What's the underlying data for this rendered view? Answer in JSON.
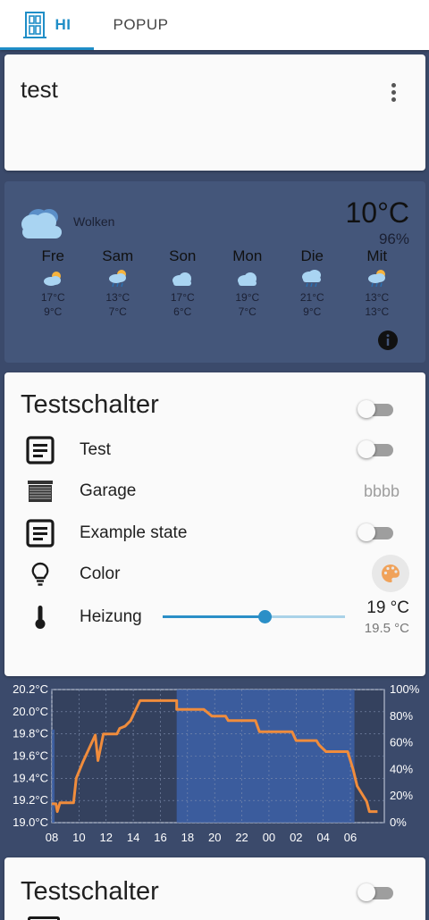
{
  "tabs": [
    {
      "label": "HI",
      "icon": "door-icon",
      "active": true
    },
    {
      "label": "POPUP",
      "active": false
    }
  ],
  "test_card": {
    "title": "test",
    "menu_icon": "dots-vertical-icon"
  },
  "weather": {
    "condition": "Wolken",
    "temperature": "10°C",
    "humidity": "96%",
    "forecast": [
      {
        "day": "Fre",
        "high": "17°C",
        "low": "9°C",
        "icon": "partly-cloudy-icon"
      },
      {
        "day": "Sam",
        "high": "13°C",
        "low": "7°C",
        "icon": "partly-cloudy-rain-icon"
      },
      {
        "day": "Son",
        "high": "17°C",
        "low": "6°C",
        "icon": "cloudy-icon"
      },
      {
        "day": "Mon",
        "high": "19°C",
        "low": "7°C",
        "icon": "cloudy-icon"
      },
      {
        "day": "Die",
        "high": "21°C",
        "low": "9°C",
        "icon": "cloudy-rain-icon"
      },
      {
        "day": "Mit",
        "high": "13°C",
        "low": "13°C",
        "icon": "partly-cloudy-rain-icon"
      }
    ]
  },
  "entities": {
    "title": "Testschalter",
    "header_toggle_on": false,
    "rows": [
      {
        "label": "Test",
        "icon": "text-box-icon",
        "type": "toggle",
        "on": false
      },
      {
        "label": "Garage",
        "icon": "garage-icon",
        "type": "state",
        "state": "bbbb"
      },
      {
        "label": "Example state",
        "icon": "text-box-icon",
        "type": "toggle",
        "on": false
      },
      {
        "label": "Color",
        "icon": "lightbulb-icon",
        "type": "color",
        "button_icon": "palette-icon"
      },
      {
        "label": "Heizung",
        "icon": "thermometer-icon",
        "type": "climate",
        "slider_fraction": 0.56,
        "current": "19 °C",
        "target": "19.5 °C"
      }
    ]
  },
  "chart_data": {
    "type": "line",
    "x_ticks": [
      "08",
      "10",
      "12",
      "14",
      "16",
      "18",
      "20",
      "22",
      "00",
      "02",
      "04",
      "06"
    ],
    "y_ticks_left": [
      "19.0°C",
      "19.2°C",
      "19.4°C",
      "19.6°C",
      "19.8°C",
      "20.0°C",
      "20.2°C"
    ],
    "y_ticks_right": [
      "0%",
      "20%",
      "40%",
      "60%",
      "80%",
      "100%"
    ],
    "ylim_left": [
      19.0,
      20.2
    ],
    "ylim_right": [
      0,
      100
    ],
    "xlim_hours": [
      8,
      8.5
    ],
    "line_color": "#f08c3c",
    "band_color": "#3d62a8",
    "series": [
      {
        "x": [
          8.0,
          8.3,
          8.4,
          8.6,
          9.6,
          9.8,
          10.3,
          11.2,
          11.4,
          11.8,
          12.8,
          13.0,
          13.4,
          13.8,
          14.5,
          17.2,
          17.2,
          19.2,
          19.8,
          20.8,
          21.0,
          23.0,
          23.3,
          25.7,
          26.0,
          27.5,
          27.7,
          28.2,
          29.8,
          30.2,
          30.5,
          31.2,
          31.4,
          32.0
        ],
        "y": [
          19.17,
          19.17,
          19.1,
          19.18,
          19.18,
          19.4,
          19.55,
          19.79,
          19.56,
          19.8,
          19.8,
          19.85,
          19.87,
          19.92,
          20.1,
          20.1,
          20.02,
          20.02,
          19.96,
          19.96,
          19.92,
          19.92,
          19.82,
          19.82,
          19.74,
          19.74,
          19.7,
          19.64,
          19.64,
          19.48,
          19.33,
          19.19,
          19.1,
          19.1
        ]
      }
    ],
    "heating_bands": [
      {
        "from": 8.0,
        "to": 8.2,
        "value": 70
      },
      {
        "from": 17.2,
        "to": 30.3,
        "value": 100
      }
    ]
  },
  "entities2": {
    "title": "Testschalter",
    "header_toggle_on": false
  }
}
